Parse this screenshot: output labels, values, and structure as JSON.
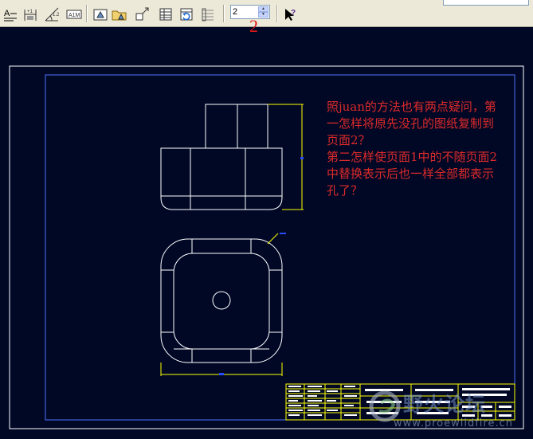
{
  "toolbar": {
    "buttons": [
      {
        "name": "text-style-icon"
      },
      {
        "name": "dimension-icon"
      },
      {
        "name": "angle-dimension-icon"
      },
      {
        "name": "datum-icon"
      },
      {
        "name": "view-icon"
      },
      {
        "name": "open-folder-view-icon"
      },
      {
        "name": "move-view-icon"
      },
      {
        "name": "table-icon"
      },
      {
        "name": "regenerate-table-icon"
      },
      {
        "name": "repeat-region-icon"
      }
    ],
    "sheet_number": "2",
    "help_button": "whats-this-help-icon"
  },
  "marker": "2",
  "annotation": {
    "text": "照juan的方法也有两点疑问，第一怎样将原先没孔的图纸复制到页面2？\n第二怎样使页面1中的不随页面2中替换表示后也一样全部都表示孔了？"
  },
  "watermark": {
    "title": "野火论坛",
    "url": "www.proewildfire.cn"
  },
  "colors": {
    "background": "#000826",
    "line": "#ffffff",
    "dimension": "#ffff00",
    "border_inner": "#4e72ff",
    "annotation": "#dd2a2a"
  }
}
